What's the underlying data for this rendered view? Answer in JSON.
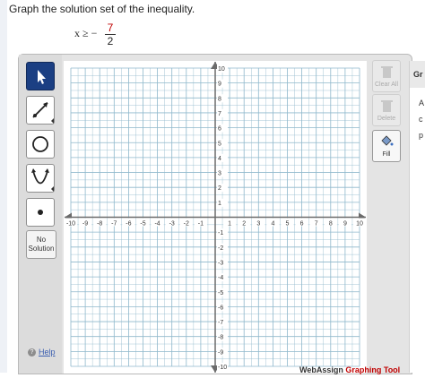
{
  "question": {
    "instruction": "Graph the solution set of the inequality.",
    "inequality_lhs": "x ≥ −",
    "fraction_numerator": "7",
    "fraction_denominator": "2"
  },
  "toolbar": {
    "tools": [
      {
        "name": "pointer",
        "active": true
      },
      {
        "name": "ray"
      },
      {
        "name": "circle"
      },
      {
        "name": "parabola"
      },
      {
        "name": "point"
      }
    ],
    "no_solution_line1": "No",
    "no_solution_line2": "Solution",
    "help_label": "Help"
  },
  "right_panel": {
    "clear_all_label": "Clear All",
    "delete_label": "Delete",
    "fill_label": "Fill"
  },
  "side_panel": {
    "heading_fragment": "Gr",
    "line1_fragment": "A",
    "line2_fragment": "c",
    "line3_fragment": "p"
  },
  "footer": {
    "brand_part1": "WebAssign",
    "brand_part2": "Graphing Tool"
  },
  "graph": {
    "x_range": [
      -10,
      10
    ],
    "y_range": [
      -10,
      10
    ],
    "x_ticks": [
      "-10",
      "-9",
      "-8",
      "-7",
      "-6",
      "-5",
      "-4",
      "-3",
      "-2",
      "-1",
      "1",
      "2",
      "3",
      "4",
      "5",
      "6",
      "7",
      "8",
      "9",
      "10"
    ],
    "y_ticks": [
      "10",
      "9",
      "8",
      "7",
      "6",
      "5",
      "4",
      "3",
      "2",
      "1",
      "-1",
      "-2",
      "-3",
      "-4",
      "-5",
      "-6",
      "-7",
      "-8",
      "-9",
      "-10"
    ],
    "grid": true,
    "grid_color": "#8fb8cc",
    "axis_color": "#6b6b6b"
  }
}
